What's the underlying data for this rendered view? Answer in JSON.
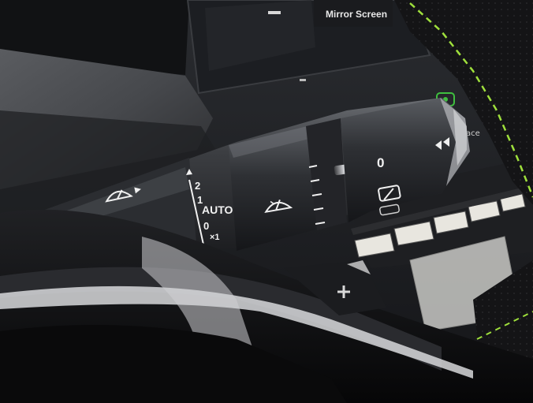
{
  "screen": {
    "button_label": "Mirror Screen"
  },
  "wiper_stalk": {
    "scale": {
      "top": "2",
      "mid": "1",
      "auto": "AUTO",
      "zero": "0",
      "single": "×1"
    },
    "rear_position_label": "0",
    "icons": [
      "front-wiper-icon",
      "front-washer-icon",
      "rear-wiper-icon",
      "rear-washer-icon"
    ]
  },
  "console": {
    "partial_label": "ace"
  },
  "colors": {
    "stitching": "#9fe03c",
    "indicator": "#3fbf3f"
  }
}
